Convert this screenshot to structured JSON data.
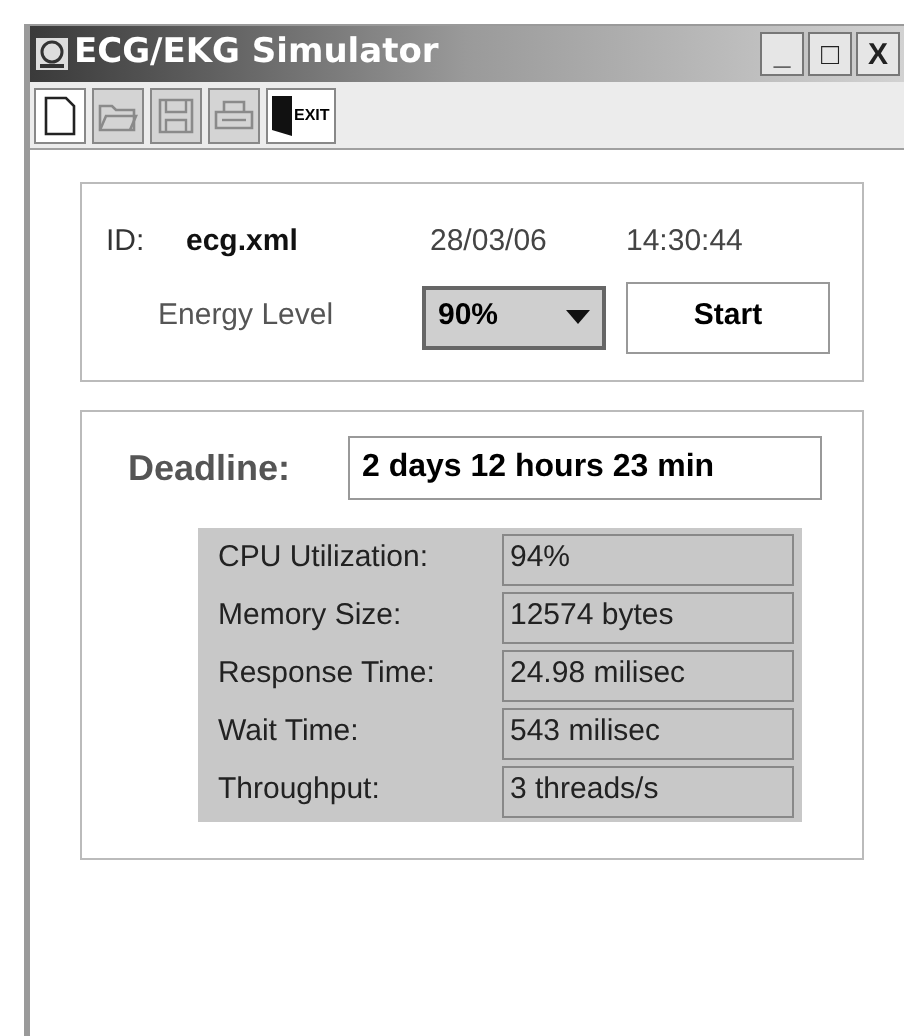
{
  "window": {
    "title": "ECG/EKG Simulator",
    "controls": [
      "_",
      "□",
      "X"
    ]
  },
  "toolbar": [
    {
      "kind": "new",
      "disabled": false
    },
    {
      "kind": "open",
      "disabled": true
    },
    {
      "kind": "save",
      "disabled": true
    },
    {
      "kind": "print",
      "disabled": true
    },
    {
      "kind": "exit",
      "label": "EXIT",
      "disabled": false
    }
  ],
  "session": {
    "id_label": "ID:",
    "id_value": "ecg.xml",
    "date": "28/03/06",
    "time": "14:30:44",
    "energy_label": "Energy Level",
    "energy_value": "90%",
    "start_button": "Start"
  },
  "deadline": {
    "label": "Deadline:",
    "value": "2 days 12 hours 23 min"
  },
  "stats": [
    {
      "label": "CPU Utilization:",
      "value": "94%"
    },
    {
      "label": "Memory Size:",
      "value": "12574 bytes"
    },
    {
      "label": "Response Time:",
      "value": "24.98 milisec"
    },
    {
      "label": "Wait Time:",
      "value": "543 milisec"
    },
    {
      "label": "Throughput:",
      "value": "3 threads/s"
    }
  ]
}
